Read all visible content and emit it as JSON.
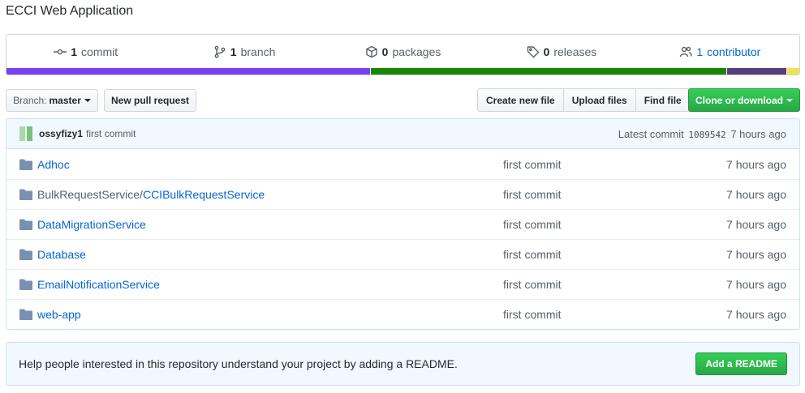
{
  "repo": {
    "description": "ECCI Web Application"
  },
  "summary": {
    "commits": {
      "count": "1",
      "label": "commit"
    },
    "branches": {
      "count": "1",
      "label": "branch"
    },
    "packages": {
      "count": "0",
      "label": "packages"
    },
    "releases": {
      "count": "0",
      "label": "releases"
    },
    "contributors": {
      "count": "1",
      "label": "contributor"
    }
  },
  "languages": [
    {
      "color": "#7b3ff2",
      "share": 46
    },
    {
      "color": "#178600",
      "share": 45
    },
    {
      "color": "#563d7c",
      "share": 7.5
    },
    {
      "color": "#f1e05a",
      "share": 1.5
    }
  ],
  "toolbar": {
    "branch_prefix": "Branch:",
    "branch_name": "master",
    "new_pr": "New pull request",
    "create_file": "Create new file",
    "upload_files": "Upload files",
    "find_file": "Find file",
    "clone": "Clone or download"
  },
  "latest_commit": {
    "author": "ossyfizy1",
    "message": "first commit",
    "prefix": "Latest commit",
    "sha": "1089542",
    "age": "7 hours ago"
  },
  "files": [
    {
      "prefix": "",
      "name": "Adhoc",
      "message": "first commit",
      "age": "7 hours ago"
    },
    {
      "prefix": "BulkRequestService/",
      "name": "CCIBulkRequestService",
      "message": "first commit",
      "age": "7 hours ago"
    },
    {
      "prefix": "",
      "name": "DataMigrationService",
      "message": "first commit",
      "age": "7 hours ago"
    },
    {
      "prefix": "",
      "name": "Database",
      "message": "first commit",
      "age": "7 hours ago"
    },
    {
      "prefix": "",
      "name": "EmailNotificationService",
      "message": "first commit",
      "age": "7 hours ago"
    },
    {
      "prefix": "",
      "name": "web-app",
      "message": "first commit",
      "age": "7 hours ago"
    }
  ],
  "readme_prompt": {
    "text": "Help people interested in this repository understand your project by adding a README.",
    "button": "Add a README"
  },
  "icons": {
    "commit": "commit-icon",
    "branch": "branch-icon",
    "package": "package-icon",
    "tag": "tag-icon",
    "people": "people-icon",
    "folder": "folder-icon"
  }
}
